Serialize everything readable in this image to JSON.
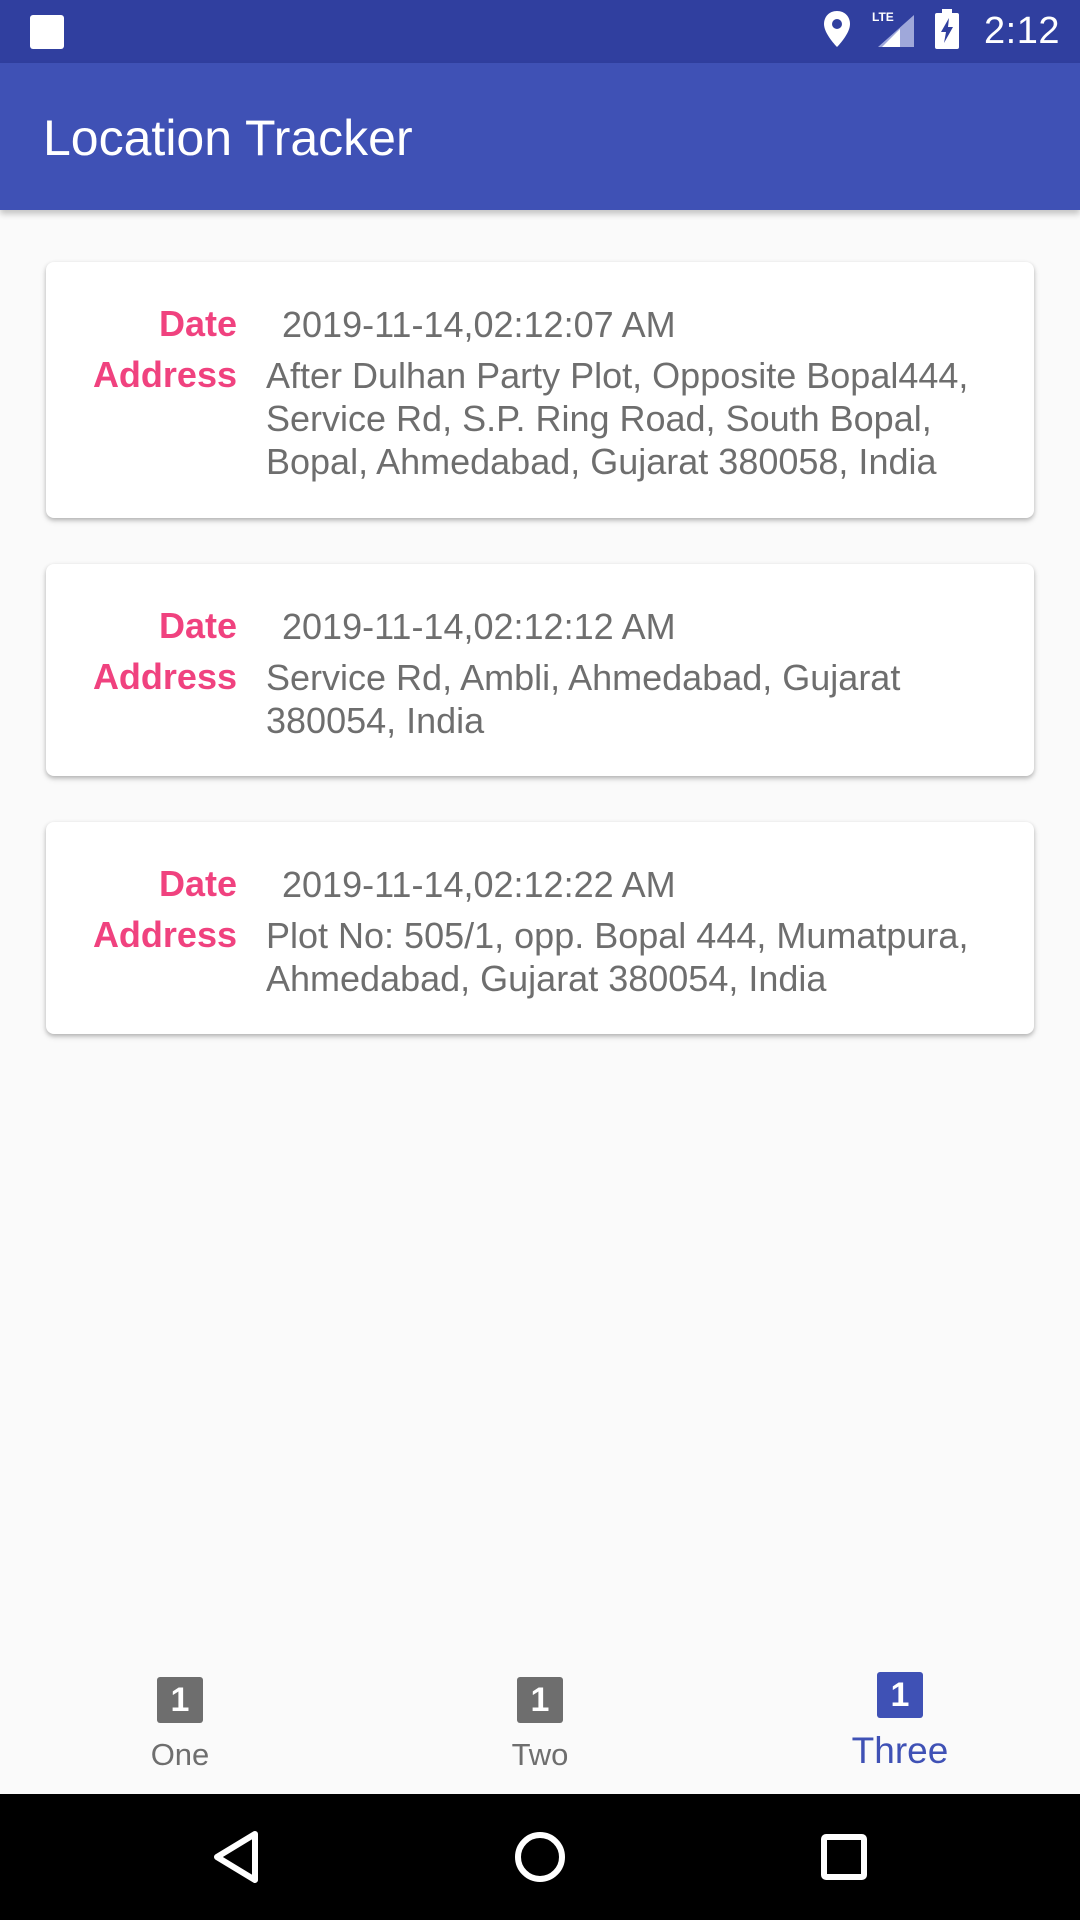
{
  "status_bar": {
    "time": "2:12",
    "network": "LTE"
  },
  "app_bar": {
    "title": "Location Tracker"
  },
  "cards": [
    {
      "date_label": "Date",
      "date_value": "2019-11-14,02:12:07 AM",
      "address_label": "Address",
      "address_value": "After Dulhan Party Plot, Opposite Bopal444, Service Rd, S.P. Ring Road, South Bopal, Bopal, Ahmedabad, Gujarat 380058, India"
    },
    {
      "date_label": "Date",
      "date_value": "2019-11-14,02:12:12 AM",
      "address_label": "Address",
      "address_value": "Service Rd, Ambli, Ahmedabad, Gujarat 380054, India"
    },
    {
      "date_label": "Date",
      "date_value": "2019-11-14,02:12:22 AM",
      "address_label": "Address",
      "address_value": "Plot No: 505/1, opp. Bopal 444, Mumatpura, Ahmedabad, Gujarat 380054, India"
    }
  ],
  "bottom_nav": {
    "items": [
      {
        "badge": "1",
        "label": "One",
        "active": false
      },
      {
        "badge": "1",
        "label": "Two",
        "active": false
      },
      {
        "badge": "1",
        "label": "Three",
        "active": true
      }
    ]
  },
  "colors": {
    "status_bar": "#303F9F",
    "app_bar": "#3F51B5",
    "label_accent": "#F0427F",
    "value_text": "#6E6E6E",
    "active_nav": "#3F51B5"
  },
  "icons": {
    "status_left": "notification-square-icon",
    "status_right": [
      "location-pin-icon",
      "lte-signal-icon",
      "battery-charging-icon"
    ],
    "system_nav": [
      "back-triangle-icon",
      "home-circle-icon",
      "recents-square-icon"
    ]
  }
}
